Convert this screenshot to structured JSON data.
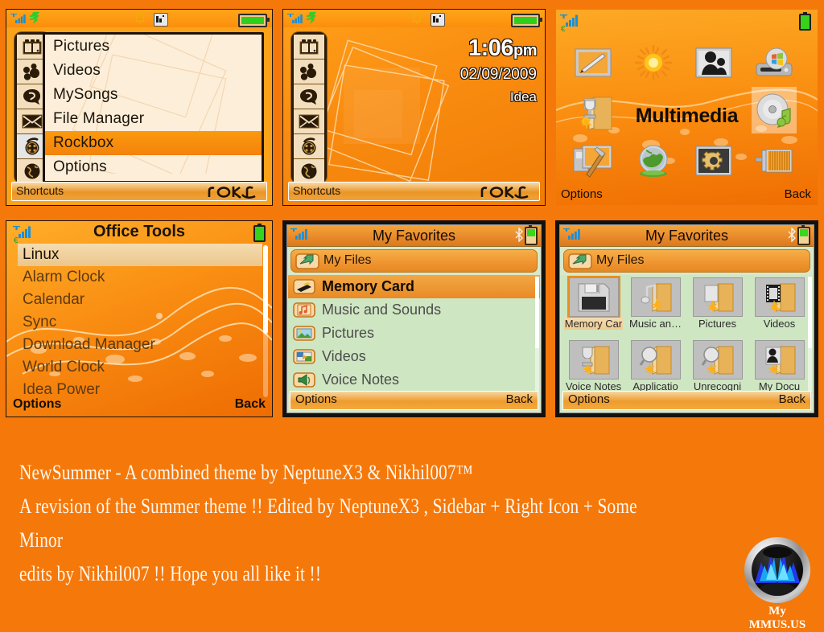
{
  "background_color": "#F5780A",
  "panels": {
    "shortcuts_menu": {
      "statusbar": {
        "signal_icon": "signal-bars-icon",
        "wifi_icon": "wifi-icon",
        "bell_icon": "bell-icon",
        "profile_icon": "profile-indicator-icon",
        "battery_icon": "battery-icon"
      },
      "sidebar_items": [
        {
          "icon": "windows-apps-icon",
          "selected": false
        },
        {
          "icon": "contacts-people-icon",
          "selected": false
        },
        {
          "icon": "message-bubble-icon",
          "selected": false
        },
        {
          "icon": "envelope-mail-icon",
          "selected": false
        },
        {
          "icon": "media-reel-icon",
          "selected": true
        },
        {
          "icon": "globe-internet-icon",
          "selected": false
        }
      ],
      "menu_items": [
        {
          "label": "Pictures",
          "selected": false
        },
        {
          "label": "Videos",
          "selected": false
        },
        {
          "label": "MySongs",
          "selected": false
        },
        {
          "label": "File Manager",
          "selected": false
        },
        {
          "label": "Rockbox",
          "selected": true
        },
        {
          "label": "Options",
          "selected": false
        }
      ],
      "softkey_left": "Shortcuts",
      "softkey_right_logo": "rokr-logo"
    },
    "standby_clock": {
      "statusbar": {
        "signal_icon": "signal-bars-icon",
        "wifi_icon": "wifi-icon",
        "bell_icon": "bell-icon",
        "profile_icon": "profile-indicator-icon",
        "battery_icon": "battery-icon"
      },
      "sidebar_items": [
        {
          "icon": "windows-apps-icon"
        },
        {
          "icon": "contacts-people-icon"
        },
        {
          "icon": "message-bubble-icon"
        },
        {
          "icon": "envelope-mail-icon"
        },
        {
          "icon": "media-reel-icon"
        },
        {
          "icon": "globe-internet-icon"
        }
      ],
      "time": "1:06",
      "time_suffix": "pm",
      "date": "02/09/2009",
      "operator": "Idea",
      "softkey_left": "Shortcuts",
      "softkey_right_logo": "rokr-logo"
    },
    "multimedia_grid": {
      "statusbar": {
        "signal_icon": "signal-bars-icon",
        "roaming_icon": "euro-roaming-icon",
        "battery_icon": "battery-icon"
      },
      "title": "Multimedia",
      "icons": [
        {
          "name": "notes-pen-icon",
          "selected": false
        },
        {
          "name": "sun-weather-icon",
          "selected": false
        },
        {
          "name": "contacts-photo-icon",
          "selected": false
        },
        {
          "name": "windows-media-drive-icon",
          "selected": false
        },
        {
          "name": "trophy-folder-icon",
          "selected": false
        },
        {
          "name": "cd-music-icon",
          "selected": true
        },
        {
          "name": "tools-monitor-icon",
          "selected": false
        },
        {
          "name": "globe-world-icon",
          "selected": false
        },
        {
          "name": "settings-gear-icon",
          "selected": false
        },
        {
          "name": "blinds-display-icon",
          "selected": false
        }
      ],
      "softkey_left": "Options",
      "softkey_right": "Back"
    },
    "office_tools": {
      "statusbar": {
        "signal_icon": "signal-bars-icon",
        "roaming_icon": "euro-roaming-icon",
        "battery_icon": "battery-icon"
      },
      "title": "Office Tools",
      "items": [
        {
          "label": "Linux",
          "selected": true
        },
        {
          "label": "Alarm Clock",
          "selected": false
        },
        {
          "label": "Calendar",
          "selected": false
        },
        {
          "label": "Sync",
          "selected": false
        },
        {
          "label": "Download Manager",
          "selected": false
        },
        {
          "label": "World Clock",
          "selected": false
        },
        {
          "label": "Idea Power",
          "selected": false
        }
      ],
      "softkey_left": "Options",
      "softkey_right": "Back"
    },
    "favorites_list": {
      "statusbar": {
        "signal_icon": "signal-bars-icon",
        "bluetooth_icon": "bluetooth-icon",
        "battery_icon": "battery-icon"
      },
      "title": "My Favorites",
      "path_label": "My Files",
      "path_icon": "my-files-folder-icon",
      "items": [
        {
          "label": "Memory Card",
          "icon": "memory-card-icon",
          "selected": true
        },
        {
          "label": "Music and Sounds",
          "icon": "music-note-icon",
          "selected": false
        },
        {
          "label": "Pictures",
          "icon": "pictures-icon",
          "selected": false
        },
        {
          "label": "Videos",
          "icon": "videos-icon",
          "selected": false
        },
        {
          "label": "Voice Notes",
          "icon": "voice-notes-icon",
          "selected": false
        }
      ],
      "softkey_left": "Options",
      "softkey_right": "Back"
    },
    "favorites_grid": {
      "statusbar": {
        "signal_icon": "signal-bars-icon",
        "bluetooth_icon": "bluetooth-icon",
        "battery_icon": "battery-icon"
      },
      "title": "My Favorites",
      "path_label": "My Files",
      "path_icon": "my-files-folder-icon",
      "cells": [
        {
          "label": "Memory Car",
          "icon": "floppy-memory-card-icon",
          "selected": true
        },
        {
          "label": "Music an…",
          "icon": "music-folder-icon",
          "selected": false
        },
        {
          "label": "Pictures",
          "icon": "pictures-folder-icon",
          "selected": false
        },
        {
          "label": "Videos",
          "icon": "videos-folder-icon",
          "selected": false
        },
        {
          "label": "Voice Notes",
          "icon": "trophy-folder-icon",
          "selected": false
        },
        {
          "label": "Applicatio",
          "icon": "applications-folder-icon",
          "selected": false
        },
        {
          "label": "Unrecogni",
          "icon": "unrecognised-folder-icon",
          "selected": false
        },
        {
          "label": "My Docu",
          "icon": "my-documents-folder-icon",
          "selected": false
        }
      ],
      "softkey_left": "Options",
      "softkey_right": "Back"
    }
  },
  "footer": {
    "line1": "NewSummer - A combined theme by NeptuneX3 & Nikhil007™",
    "line2": "A revision of the Summer theme !! Edited by NeptuneX3 , Sidebar + Right Icon + Some Minor",
    "line3": "edits by Nikhil007 !!  Hope you all like it !!",
    "logo_text": "My MMUS.US",
    "logo_icon": "mmus-waveform-logo"
  }
}
